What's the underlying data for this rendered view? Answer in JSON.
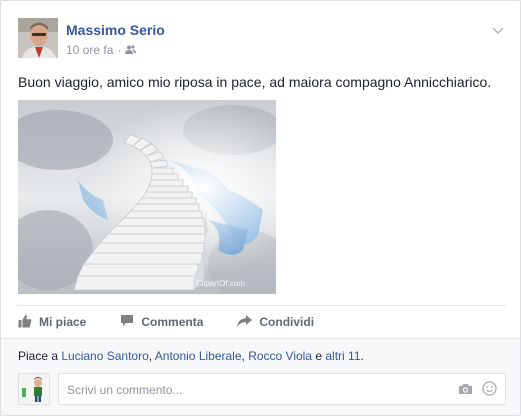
{
  "post": {
    "author": "Massimo Serio",
    "time": "10 ore fa",
    "separator": "·",
    "audience_icon": "friends-icon",
    "text": "Buon viaggio, amico mio riposa in pace, ad maiora compagno Annicchiarico."
  },
  "actions": {
    "like": "Mi piace",
    "comment": "Commenta",
    "share": "Condividi"
  },
  "likes": {
    "prefix": "Piace a ",
    "person1": "Luciano Santoro",
    "sep1": ", ",
    "person2": "Antonio Liberale",
    "sep2": ", ",
    "person3": "Rocco Viola",
    "conj": " e ",
    "others": "altri 11",
    "suffix": "."
  },
  "comment": {
    "placeholder": "Scrivi un commento..."
  },
  "photo": {
    "watermark": "ClipartOf.com"
  },
  "colors": {
    "link": "#365899",
    "muted": "#90949c",
    "sky": "#6fa7dc"
  }
}
